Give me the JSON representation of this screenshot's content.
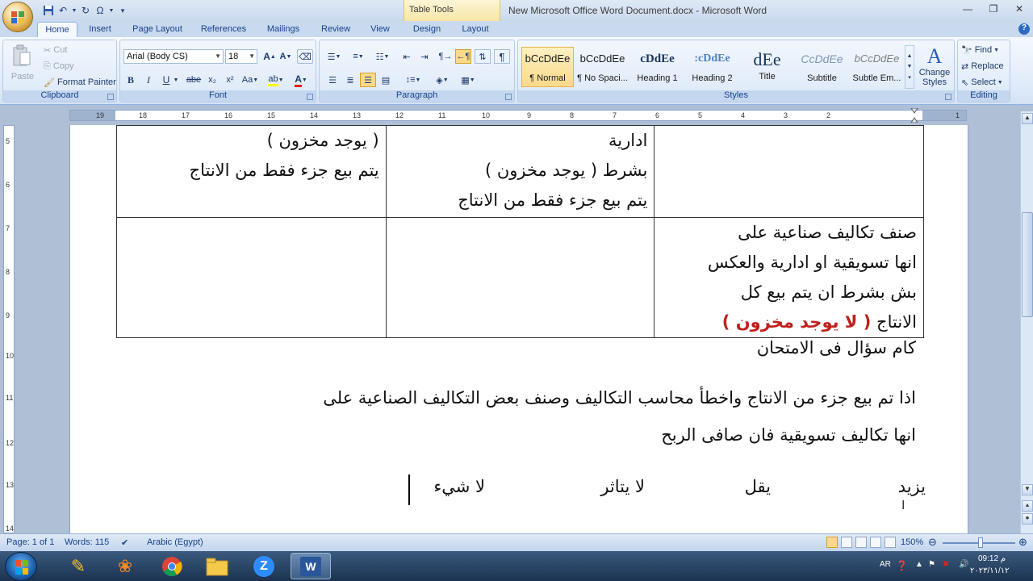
{
  "window": {
    "contextual_group": "Table Tools",
    "title": "New Microsoft Office Word Document.docx - Microsoft Word"
  },
  "tabs": [
    "Home",
    "Insert",
    "Page Layout",
    "References",
    "Mailings",
    "Review",
    "View",
    "Design",
    "Layout"
  ],
  "ribbon": {
    "clipboard": {
      "label": "Clipboard",
      "paste": "Paste",
      "cut": "Cut",
      "copy": "Copy",
      "format_painter": "Format Painter"
    },
    "font": {
      "label": "Font",
      "font_name": "Arial (Body CS)",
      "font_size": "18",
      "bold": "B",
      "italic": "I",
      "underline": "U",
      "strike": "abe",
      "subscript": "x₂",
      "superscript": "x²",
      "change_case": "Aa",
      "font_color": "A"
    },
    "paragraph": {
      "label": "Paragraph",
      "show_marks": "¶"
    },
    "styles": {
      "label": "Styles",
      "items": [
        {
          "sample": "bCcDdEe",
          "name": "¶ Normal"
        },
        {
          "sample": "bCcDdEe",
          "name": "¶ No Spaci..."
        },
        {
          "sample": "cDdEe",
          "name": "Heading 1"
        },
        {
          "sample": ":cDdEe",
          "name": "Heading 2"
        },
        {
          "sample": "dEe",
          "name": "Title"
        },
        {
          "sample": "CcDdEe",
          "name": "Subtitle"
        },
        {
          "sample": "bCcDdEe",
          "name": "Subtle Em..."
        }
      ],
      "change_styles": "Change Styles"
    },
    "editing": {
      "label": "Editing",
      "find": "Find",
      "replace": "Replace",
      "select": "Select"
    }
  },
  "ruler": {
    "h_numbers": [
      "19",
      "18",
      "17",
      "16",
      "15",
      "14",
      "13",
      "12",
      "11",
      "10",
      "9",
      "8",
      "7",
      "6",
      "5",
      "4",
      "3",
      "2",
      "1"
    ],
    "v_numbers": [
      "5",
      "6",
      "7",
      "8",
      "9",
      "10",
      "11",
      "12",
      "13",
      "14"
    ]
  },
  "document": {
    "row1": {
      "col_left": [
        "( يوجد مخزون )",
        "يتم بيع جزء فقط من الانتاج"
      ],
      "col_mid": [
        "ادارية",
        "بشرط ( يوجد مخزون )",
        "يتم بيع جزء فقط من الانتاج"
      ]
    },
    "row2": {
      "col_right_lines": [
        "صنف تكاليف صناعية على",
        "انها تسويقية او ادارية والعكس",
        "بش بشرط ان يتم بيع كل"
      ],
      "col_right_last_prefix": "الانتاج",
      "col_right_last_red": "( لا يوجد مخزون )"
    },
    "para1": "كام سؤال فى الامتحان",
    "para2_line1": "اذا تم بيع جزء من الانتاج واخطأ محاسب التكاليف وصنف بعض التكاليف الصناعية على",
    "para2_line2": "انها تكاليف تسويقية فان صافى الربح",
    "options": [
      "يزيد",
      "يقل",
      "لا يتاثر",
      "لا شيء"
    ]
  },
  "status": {
    "page": "Page: 1 of 1",
    "words": "Words: 115",
    "language": "Arabic (Egypt)",
    "zoom": "150%"
  },
  "taskbar": {
    "lang": "AR",
    "time": "09:12 م",
    "date": "٢٠٢٣/١١/١٢"
  }
}
